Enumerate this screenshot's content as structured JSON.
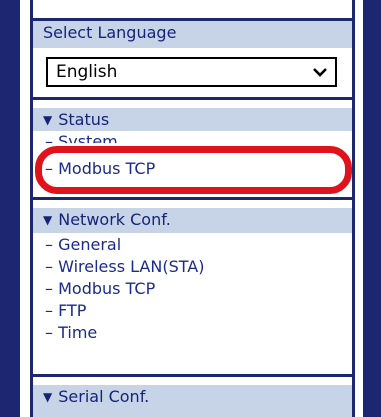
{
  "language": {
    "header": "Select Language",
    "selected": "English"
  },
  "status": {
    "header": "Status",
    "items": [
      "System",
      "Modbus TCP"
    ]
  },
  "network_conf": {
    "header": "Network Conf.",
    "items": [
      "General",
      "Wireless LAN(STA)",
      "Modbus TCP",
      "FTP",
      "Time"
    ]
  },
  "serial_conf": {
    "header": "Serial Conf."
  },
  "glyphs": {
    "triangle": "▼",
    "dash": "–"
  },
  "colors": {
    "frame": "#1d2771",
    "header_bg": "#c7d4e7",
    "highlight": "#e0131c"
  }
}
